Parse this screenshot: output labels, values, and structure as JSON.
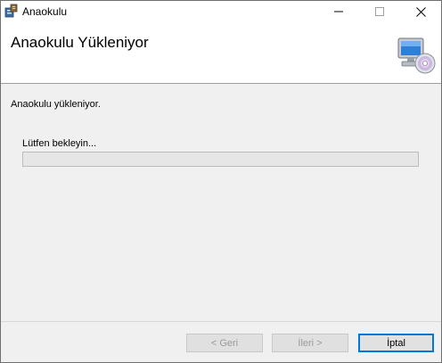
{
  "window": {
    "title": "Anaokulu",
    "controls": {
      "minimize": "minimize",
      "maximize": "maximize",
      "close": "close"
    }
  },
  "banner": {
    "heading": "Anaokulu Yükleniyor",
    "icon": "computer-cd-icon"
  },
  "body": {
    "status": "Anaokulu yükleniyor.",
    "wait_label": "Lütfen bekleyin...",
    "progress_fraction": 0
  },
  "buttons": {
    "back": "< Geri",
    "next": "İleri >",
    "cancel": "İptal"
  },
  "colors": {
    "accent": "#0078d7"
  }
}
